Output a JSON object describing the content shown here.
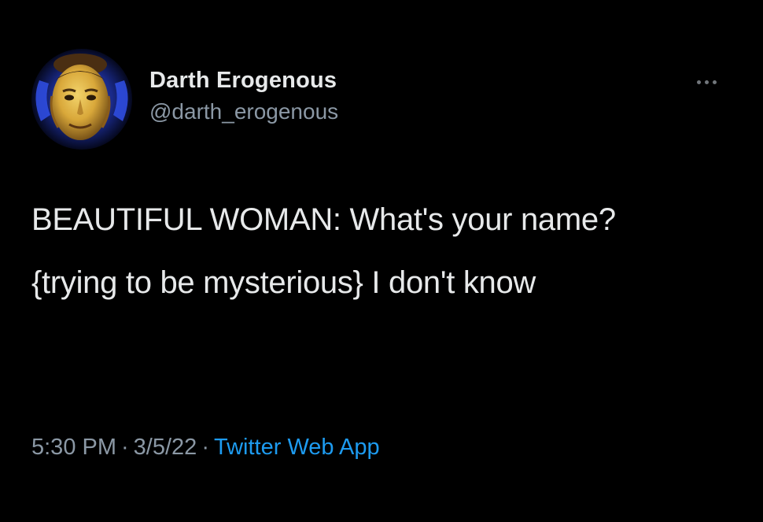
{
  "author": {
    "display_name": "Darth Erogenous",
    "handle": "@darth_erogenous"
  },
  "menu": {
    "icon": "more-horizontal-icon"
  },
  "tweet": {
    "paragraphs": [
      "BEAUTIFUL WOMAN: What's your name?",
      "{trying to be mysterious} I don't know"
    ]
  },
  "meta": {
    "time": "5:30 PM",
    "separator": "·",
    "date": "3/5/22",
    "source": "Twitter Web App"
  },
  "colors": {
    "background": "#000000",
    "text_primary": "#e7e9ea",
    "text_secondary": "#8b98a5",
    "link": "#1d9bf0"
  }
}
